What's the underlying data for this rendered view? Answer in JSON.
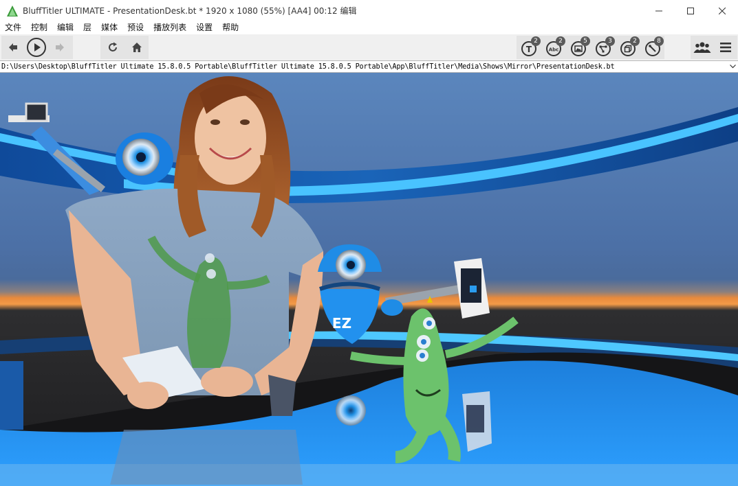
{
  "window": {
    "app_name": "BluffTitler ULTIMATE",
    "title_rest": " - PresentationDesk.bt * 1920 x 1080 (55%) [AA4] 00:12 编辑"
  },
  "menu": [
    "文件",
    "控制",
    "编辑",
    "层",
    "媒体",
    "预设",
    "播放列表",
    "设置",
    "帮助"
  ],
  "toolbar": {
    "badges": {
      "text": "2",
      "abc": "2",
      "picture": "5",
      "nodes": "3",
      "cube": "2",
      "tools": "8"
    }
  },
  "path": {
    "value": "D:\\Users\\Desktop\\BluffTitler Ultimate 15.8.0.5 Portable\\BluffTitler Ultimate 15.8.0.5 Portable\\App\\BluffTitler\\Media\\Shows\\Mirror\\PresentationDesk.bt"
  },
  "viewport": {
    "shirt_logo": "EZ",
    "colors": {
      "sky": "#4f78b0",
      "horizon": "#f5963c",
      "floor": "#2a8de8",
      "stripe": "#4ec8ff"
    }
  }
}
